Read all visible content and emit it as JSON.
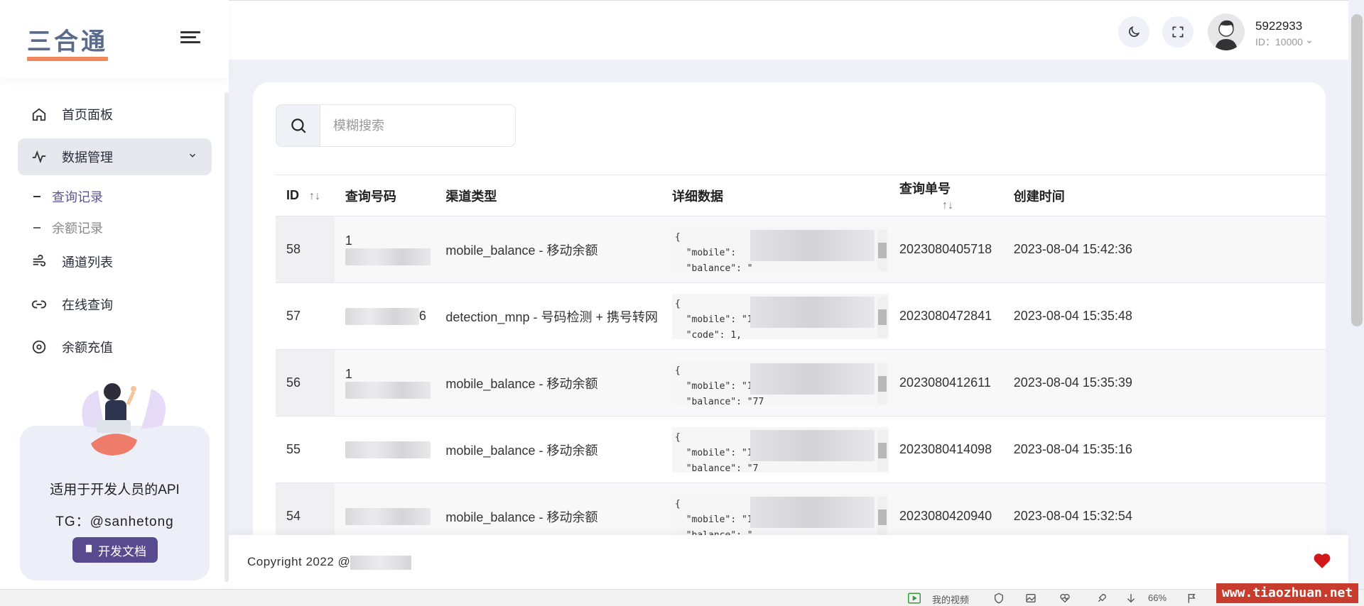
{
  "sidebar": {
    "logo": "三合通",
    "nav": [
      {
        "label": "首页面板",
        "icon": "home-icon"
      },
      {
        "label": "数据管理",
        "icon": "activity-icon"
      },
      {
        "label": "通道列表",
        "icon": "wind-icon"
      },
      {
        "label": "在线查询",
        "icon": "link-icon"
      },
      {
        "label": "余额充值",
        "icon": "target-icon"
      }
    ],
    "sub": [
      {
        "label": "查询记录",
        "active": true
      },
      {
        "label": "余额记录",
        "active": false
      }
    ],
    "promo": {
      "text": "适用于开发人员的API",
      "tg": "TG：@sanhetong",
      "button": "开发文档"
    }
  },
  "topbar": {
    "username": "5922933",
    "user_id": "ID：10000"
  },
  "search": {
    "placeholder": "模糊搜索"
  },
  "table": {
    "headers": [
      "ID",
      "查询号码",
      "渠道类型",
      "详细数据",
      "查询单号",
      "创建时间"
    ],
    "rows": [
      {
        "id": "58",
        "phone": "1",
        "channel": "mobile_balance - 移动余额",
        "detail": "{\n  \"mobile\":\n  \"balance\": \"",
        "order": "2023080405718",
        "time": "2023-08-04 15:42:36"
      },
      {
        "id": "57",
        "phone": "6",
        "channel": "detection_mnp - 号码检测 + 携号转网",
        "detail": "{\n  \"mobile\": \"18\n  \"code\": 1,",
        "order": "2023080472841",
        "time": "2023-08-04 15:35:48"
      },
      {
        "id": "56",
        "phone": "1",
        "channel": "mobile_balance - 移动余额",
        "detail": "{\n  \"mobile\": \"1\n  \"balance\": \"77",
        "order": "2023080412611",
        "time": "2023-08-04 15:35:39"
      },
      {
        "id": "55",
        "phone": "",
        "channel": "mobile_balance - 移动余额",
        "detail": "{\n  \"mobile\": \"188\n  \"balance\": \"7",
        "order": "2023080414098",
        "time": "2023-08-04 15:35:16"
      },
      {
        "id": "54",
        "phone": "",
        "channel": "mobile_balance - 移动余额",
        "detail": "{\n  \"mobile\": \"18\n  \"balance\": \"",
        "order": "2023080420940",
        "time": "2023-08-04 15:32:54"
      }
    ]
  },
  "footer": {
    "copyright": "Copyright 2022 @"
  },
  "statusbar": {
    "video": "我的视频",
    "zoom": "66%"
  },
  "watermark": "www.tiaozhuan.net"
}
